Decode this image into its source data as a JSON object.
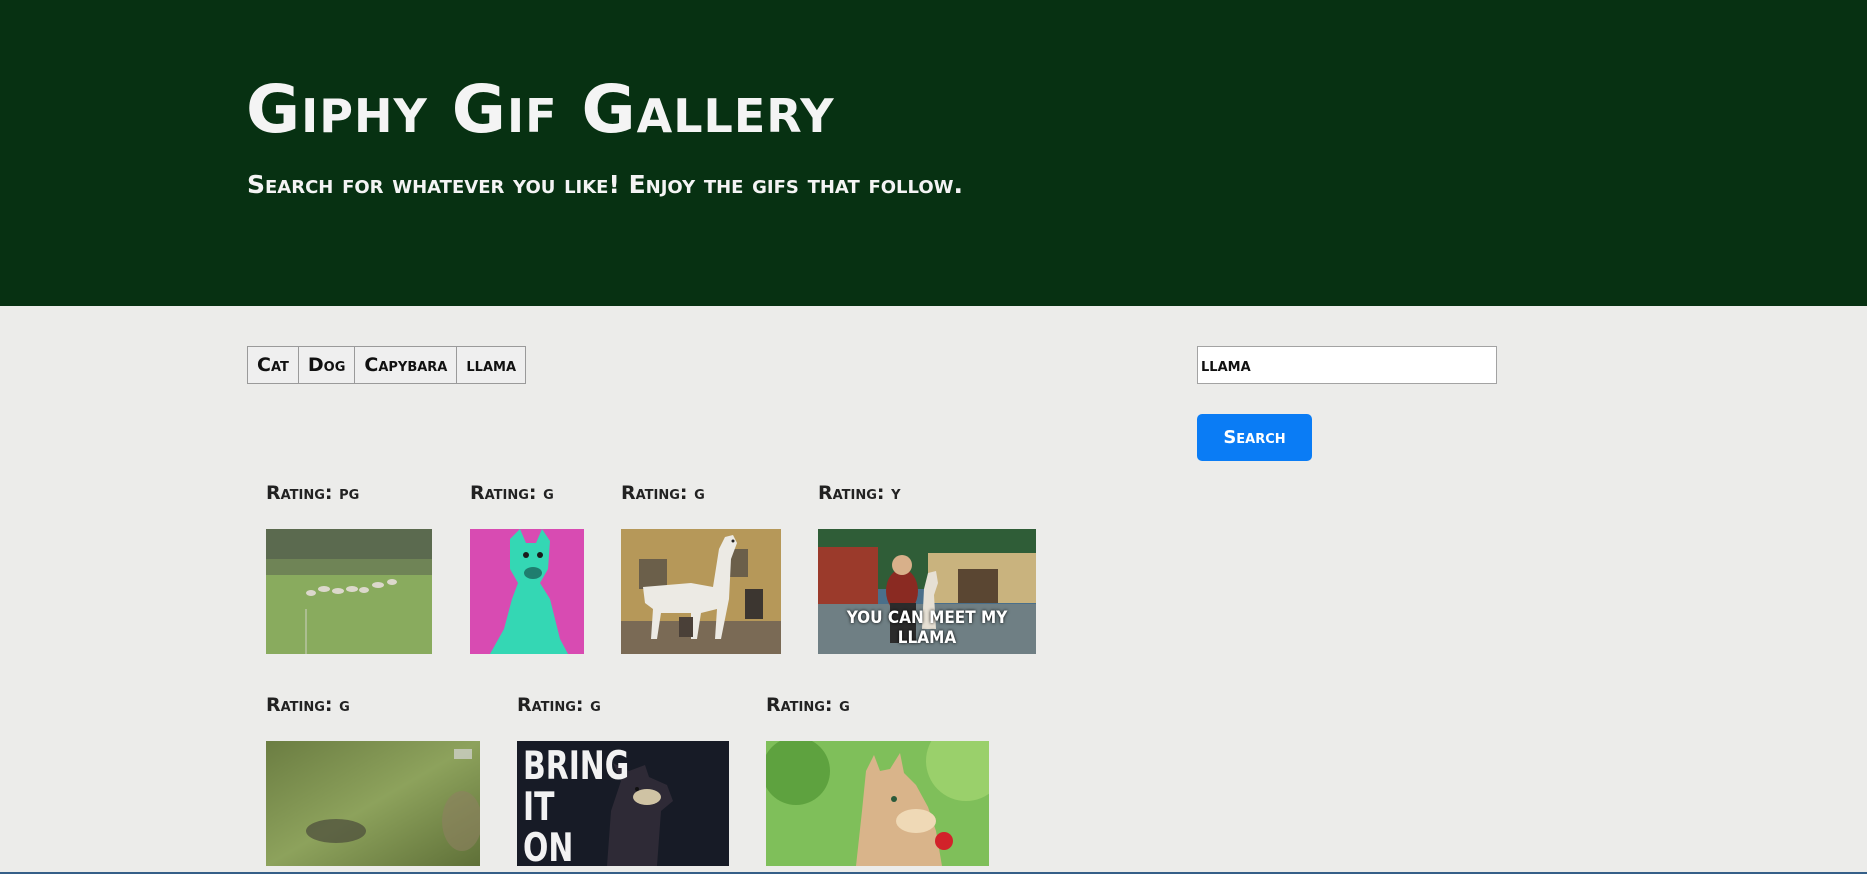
{
  "header": {
    "title": "Giphy Gif Gallery",
    "subtitle": "Search for whatever you like! Enjoy the gifs that follow."
  },
  "topic_buttons": [
    "Cat",
    "Dog",
    "Capybara",
    "llama"
  ],
  "search": {
    "value": "llama",
    "button_label": "Search"
  },
  "gifs": [
    {
      "rating_text": "Rating: pg",
      "scene": "sheep-field"
    },
    {
      "rating_text": "Rating: g",
      "scene": "neon-llama"
    },
    {
      "rating_text": "Rating: g",
      "scene": "llama-living-room"
    },
    {
      "rating_text": "Rating: y",
      "scene": "meet-my-llama",
      "caption": "YOU CAN MEET MY LLAMA"
    },
    {
      "rating_text": "Rating: g",
      "scene": "blurry-anteater"
    },
    {
      "rating_text": "Rating: g",
      "scene": "bring-it-on-llama",
      "caption": "BRING\nIT\nON"
    },
    {
      "rating_text": "Rating: g",
      "scene": "anime-llama-rose"
    }
  ],
  "colors": {
    "header_bg": "#073112",
    "page_bg": "#ececea",
    "search_button": "#0a7cf5"
  }
}
